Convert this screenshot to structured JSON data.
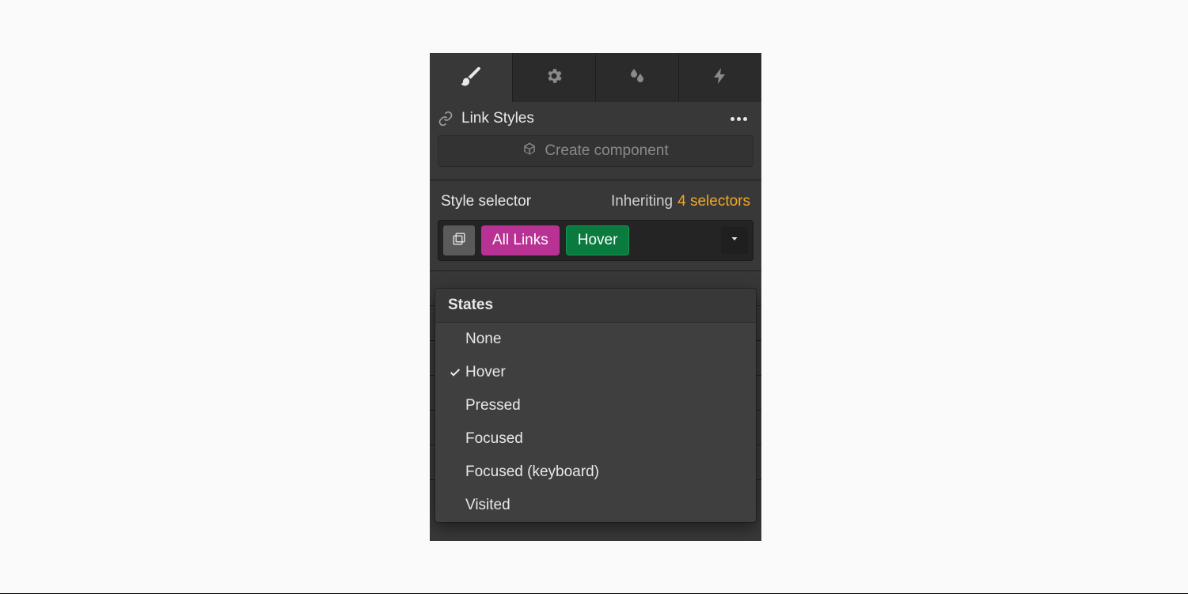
{
  "tabs": [
    {
      "name": "style",
      "icon": "brush-icon",
      "active": true
    },
    {
      "name": "settings",
      "icon": "gear-icon",
      "active": false
    },
    {
      "name": "effects",
      "icon": "drops-icon",
      "active": false
    },
    {
      "name": "interactions",
      "icon": "bolt-icon",
      "active": false
    }
  ],
  "header": {
    "title": "Link Styles"
  },
  "create_component": {
    "label": "Create component"
  },
  "selector": {
    "title": "Style selector",
    "inherit_label": "Inheriting",
    "inherit_count": "4 selectors",
    "chips": [
      {
        "label": "All Links",
        "style": "magenta"
      },
      {
        "label": "Hover",
        "style": "green"
      }
    ]
  },
  "dropdown": {
    "header": "States",
    "selected": "Hover",
    "items": [
      "None",
      "Hover",
      "Pressed",
      "Focused",
      "Focused (keyboard)",
      "Visited"
    ]
  },
  "colors": {
    "accent_orange": "#f5a623",
    "chip_magenta": "#b83294",
    "chip_green": "#0a7a3f"
  }
}
